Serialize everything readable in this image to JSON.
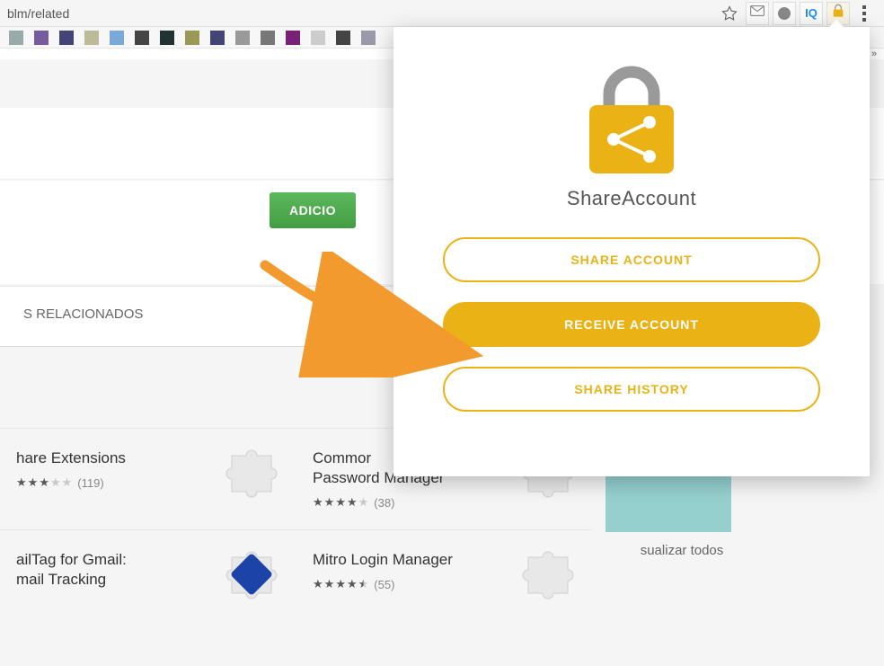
{
  "addressBar": {
    "url": "blm/related",
    "iqLabel": "IQ"
  },
  "bookmarksMore": "»",
  "installBtn": "ADICIO",
  "tabs": {
    "related": "S RELACIONADOS"
  },
  "extensions": {
    "row1": {
      "card1": {
        "title": "hare Extensions",
        "reviews": "(119)"
      },
      "card2": {
        "title": "Commor\nPassword Manager",
        "reviews": "(38)"
      }
    },
    "row2": {
      "card1": {
        "title": "ailTag for Gmail:\nmail Tracking",
        "reviews": ""
      },
      "card2": {
        "title": "Mitro Login Manager",
        "reviews": "(55)"
      }
    }
  },
  "rightPanel": {
    "viewAll": "sualizar todos"
  },
  "popup": {
    "title": "ShareAccount",
    "shareBtn": "SHARE ACCOUNT",
    "receiveBtn": "RECEIVE ACCOUNT",
    "historyBtn": "SHARE HISTORY"
  }
}
